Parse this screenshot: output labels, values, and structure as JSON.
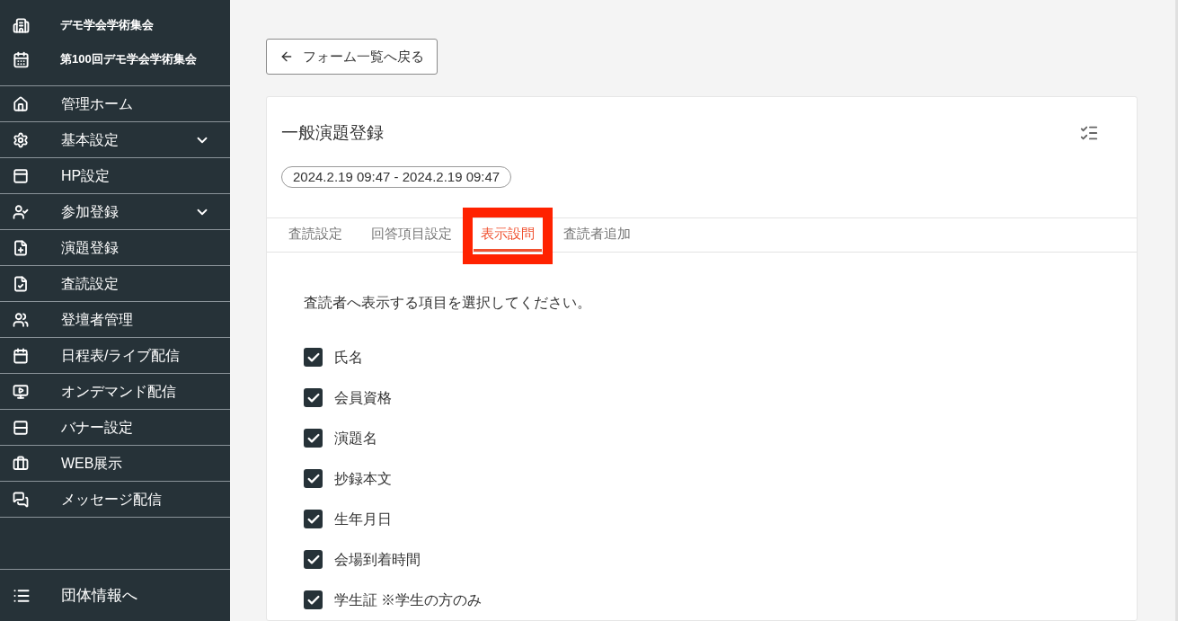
{
  "sidebar": {
    "header": [
      "デモ学会学術集会",
      "第100回デモ学会学術集会"
    ],
    "items": [
      {
        "label": "管理ホーム",
        "expandable": false
      },
      {
        "label": "基本設定",
        "expandable": true
      },
      {
        "label": "HP設定",
        "expandable": false
      },
      {
        "label": "参加登録",
        "expandable": true
      },
      {
        "label": "演題登録",
        "expandable": false
      },
      {
        "label": "査読設定",
        "expandable": false
      },
      {
        "label": "登壇者管理",
        "expandable": false
      },
      {
        "label": "日程表/ライブ配信",
        "expandable": false
      },
      {
        "label": "オンデマンド配信",
        "expandable": false
      },
      {
        "label": "バナー設定",
        "expandable": false
      },
      {
        "label": "WEB展示",
        "expandable": false
      },
      {
        "label": "メッセージ配信",
        "expandable": false
      }
    ],
    "footer": "団体情報へ"
  },
  "back_button": "フォーム一覧へ戻る",
  "form": {
    "title": "一般演題登録",
    "period": "2024.2.19 09:47 - 2024.2.19 09:47",
    "tabs": [
      {
        "label": "査読設定",
        "selected": false,
        "highlighted": false
      },
      {
        "label": "回答項目設定",
        "selected": false,
        "highlighted": false
      },
      {
        "label": "表示設問",
        "selected": true,
        "highlighted": true
      },
      {
        "label": "査読者追加",
        "selected": false,
        "highlighted": false
      }
    ],
    "instruction": "査読者へ表示する項目を選択してください。",
    "options": [
      {
        "label": "氏名",
        "checked": true
      },
      {
        "label": "会員資格",
        "checked": true
      },
      {
        "label": "演題名",
        "checked": true
      },
      {
        "label": "抄録本文",
        "checked": true
      },
      {
        "label": "生年月日",
        "checked": true
      },
      {
        "label": "会場到着時間",
        "checked": true
      },
      {
        "label": "学生証 ※学生の方のみ",
        "checked": true
      }
    ]
  }
}
